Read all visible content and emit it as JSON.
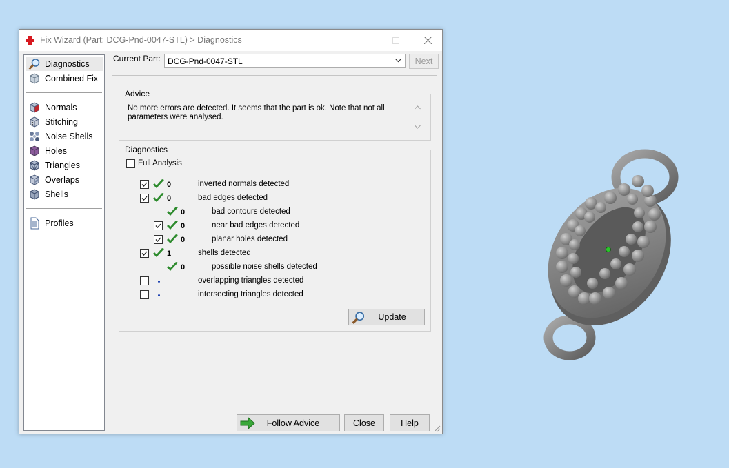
{
  "window": {
    "title": "Fix Wizard (Part: DCG-Pnd-0047-STL) > Diagnostics",
    "controls": [
      "minimize-icon",
      "maximize-icon",
      "close-icon"
    ]
  },
  "sidebar": {
    "items": [
      {
        "label": "Diagnostics",
        "icon": "magnifier-icon",
        "active": true
      },
      {
        "label": "Combined Fix",
        "icon": "cube-icon"
      },
      {
        "label": "Normals",
        "icon": "normals-cube-icon"
      },
      {
        "label": "Stitching",
        "icon": "stitching-cube-icon"
      },
      {
        "label": "Noise Shells",
        "icon": "noise-shells-icon"
      },
      {
        "label": "Holes",
        "icon": "holes-cube-icon"
      },
      {
        "label": "Triangles",
        "icon": "triangles-cube-icon"
      },
      {
        "label": "Overlaps",
        "icon": "overlaps-cube-icon"
      },
      {
        "label": "Shells",
        "icon": "shells-cube-icon"
      },
      {
        "label": "Profiles",
        "icon": "document-icon"
      }
    ]
  },
  "header": {
    "current_part_label": "Current Part:",
    "current_part_value": "DCG-Pnd-0047-STL",
    "next_label": "Next"
  },
  "advice": {
    "legend": "Advice",
    "text": "No more errors are detected. It seems that the part is ok. Note that not all parameters were analysed."
  },
  "diagnostics": {
    "legend": "Diagnostics",
    "full_analysis_label": "Full Analysis",
    "full_analysis_checked": false,
    "rows": [
      {
        "checked": true,
        "status": "ok",
        "count": "0",
        "label": "inverted normals detected"
      },
      {
        "checked": true,
        "status": "ok",
        "count": "0",
        "label": "bad edges detected"
      },
      {
        "checked": null,
        "status": "ok",
        "count": "0",
        "label": "bad contours detected"
      },
      {
        "checked": true,
        "status": "ok",
        "count": "0",
        "label": "near bad edges detected"
      },
      {
        "checked": true,
        "status": "ok",
        "count": "0",
        "label": "planar holes detected"
      },
      {
        "checked": true,
        "status": "ok",
        "count": "1",
        "label": "shells detected"
      },
      {
        "checked": null,
        "status": "ok",
        "count": "0",
        "label": "possible noise shells detected"
      },
      {
        "checked": false,
        "status": "not-analysed",
        "count": "",
        "label": "overlapping triangles detected"
      },
      {
        "checked": false,
        "status": "not-analysed",
        "count": "",
        "label": "intersecting triangles detected"
      }
    ],
    "update_label": "Update"
  },
  "footer": {
    "follow_advice_label": "Follow Advice",
    "close_label": "Close",
    "help_label": "Help"
  },
  "colors": {
    "desktop": "#bddcf5",
    "check_green": "#2e8b2e",
    "not_analysed_dot": "#1a3fb0",
    "model_gray": "#8c8c8c"
  }
}
